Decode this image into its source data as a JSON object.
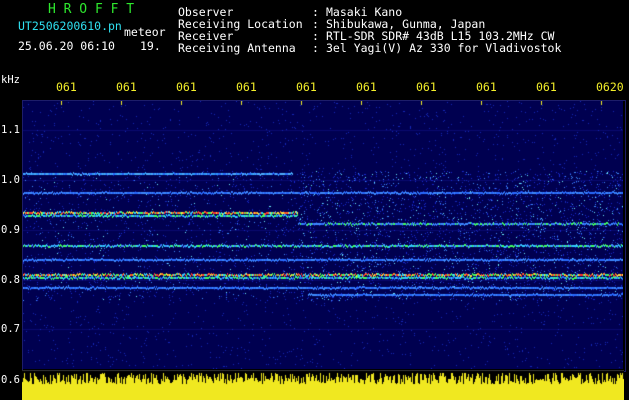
{
  "header": {
    "app_title": "H R O F F T",
    "filename": "UT2506200610.pn",
    "filename_suffix": "meteor",
    "date_time": "25.06.20 06:10",
    "count": "19.",
    "info": [
      {
        "key": "Observer",
        "value": "Masaki Kano"
      },
      {
        "key": "Receiving Location",
        "value": "Shibukawa, Gunma, Japan"
      },
      {
        "key": "Receiver",
        "value": "RTL-SDR SDR# 43dB L15 103.2MHz CW"
      },
      {
        "key": "Receiving Antenna",
        "value": "3el Yagi(V) Az 330 for Vladivostok"
      }
    ]
  },
  "axis": {
    "unit": "kHz",
    "y_ticks": [
      "1.1",
      "1.0",
      "0.9",
      "0.8",
      "0.7",
      "0.6"
    ],
    "x_ticks": [
      "061",
      "061",
      "061",
      "061",
      "061",
      "061",
      "061",
      "061",
      "061",
      "0620"
    ]
  },
  "colors": {
    "background": "#000000",
    "plot": "#000050",
    "label_green": "#2ee82e",
    "label_cyan": "#2fe0f0",
    "tick_yellow": "#f2ee2a"
  }
}
